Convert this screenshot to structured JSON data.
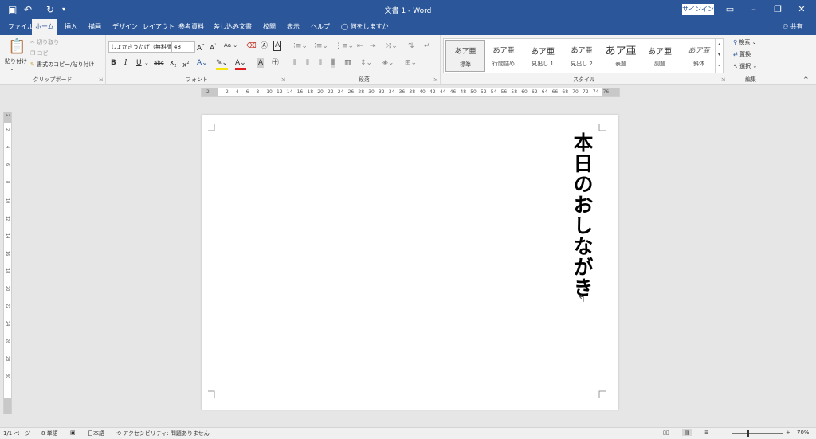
{
  "window": {
    "title": "文書 1  -  Word",
    "signin": "サインイン",
    "quick_access": {
      "save_icon": "save-icon",
      "undo_icon": "undo-icon",
      "redo_icon": "redo-icon"
    }
  },
  "tabs": [
    "ファイル",
    "ホーム",
    "挿入",
    "描画",
    "デザイン",
    "レイアウト",
    "参考資料",
    "差し込み文書",
    "校閲",
    "表示",
    "ヘルプ"
  ],
  "active_tab": "ホーム",
  "tell_me": "何をしますか",
  "share": "共有",
  "ribbon": {
    "clipboard": {
      "label": "クリップボード",
      "paste": "貼り付け",
      "cut": "切り取り",
      "copy": "コピー",
      "format_painter": "書式のコピー/貼り付け"
    },
    "font": {
      "label": "フォント",
      "font_name": "しょかきうたげ（無料版）",
      "font_size": "48",
      "aa": "Aa"
    },
    "paragraph": {
      "label": "段落"
    },
    "styles": {
      "label": "スタイル",
      "sample": "あア亜",
      "items": [
        "標準",
        "行間詰め",
        "見出し 1",
        "見出し 2",
        "表題",
        "副題",
        "斜体"
      ]
    },
    "editing": {
      "label": "編集",
      "find": "検索",
      "replace": "置換",
      "select": "選択"
    }
  },
  "ruler": {
    "numbers": [
      "2",
      "2",
      "4",
      "6",
      "8",
      "10",
      "12",
      "14",
      "16",
      "18",
      "20",
      "22",
      "24",
      "26",
      "28",
      "30",
      "32",
      "34",
      "36",
      "38",
      "40",
      "42",
      "44",
      "46",
      "48",
      "50",
      "52",
      "54",
      "56",
      "58",
      "60",
      "62",
      "64",
      "66",
      "68",
      "70",
      "72",
      "74",
      "76"
    ],
    "vertical_numbers": [
      "2",
      "2",
      "4",
      "6",
      "8",
      "10",
      "12",
      "14",
      "16",
      "18",
      "20",
      "22",
      "24",
      "26",
      "28",
      "30"
    ]
  },
  "document": {
    "text": "本日のおしながき"
  },
  "status": {
    "page": "1/1 ページ",
    "words": "8 単語",
    "language": "日本語",
    "accessibility": "アクセシビリティ: 問題ありません",
    "zoom": "70%"
  }
}
